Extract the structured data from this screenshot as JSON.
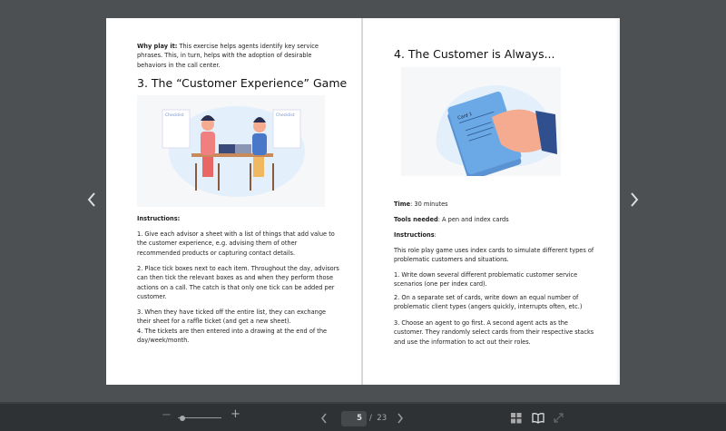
{
  "left_page": {
    "why_label": "Why play it:",
    "why_text": " This exercise helps agents identify key service phrases. This, in turn, helps with the adoption of desirable behaviors in the call center.",
    "heading": "3. The “Customer Experience” Game",
    "illustration_labels": [
      "Checklist",
      "Checklist"
    ],
    "instructions_label": "Instructions:",
    "steps": [
      "1. Give each advisor a sheet with a list of things that add value to the customer experience, e.g. advising them of other recommended products or capturing contact details.",
      "2. Place tick boxes next to each item. Throughout the day, advisors can then tick the relevant boxes as and when they perform those actions on a call. The catch is that only one tick can be added per customer.",
      "3. When they have ticked off the entire list, they can exchange their sheet for a raffle ticket (and get a new sheet).",
      "4. The tickets are then entered into a drawing at the end of the day/week/month."
    ]
  },
  "right_page": {
    "heading": "4. The Customer is Always...",
    "card_label": "Card 1",
    "time_label": "Time",
    "time_value": ": 30 minutes",
    "tools_label": "Tools needed",
    "tools_value": ": A pen and index cards",
    "instructions_label": "Instructions",
    "instructions_colon": ":",
    "intro": "This role play game uses index cards to simulate different types of problematic customers and situations.",
    "steps": [
      "1. Write down several different problematic customer service scenarios (one per index card).",
      "2. On a separate set of cards, write down an equal number of problematic client types (angers quickly, interrupts often, etc.)",
      "3. Choose an agent to go first. A second agent acts as the customer. They randomly select cards from their respective stacks and use the information to act out their roles."
    ]
  },
  "toolbar": {
    "zoom_out": "−",
    "zoom_in": "+",
    "zoom_level": 0.1,
    "current_page": "5",
    "separator": "/",
    "total_pages": "23"
  },
  "colors": {
    "card_blue": "#6aa8e6",
    "skin": "#f4ab8f",
    "sleeve": "#2f4f8f",
    "blob": "#e3effb"
  }
}
